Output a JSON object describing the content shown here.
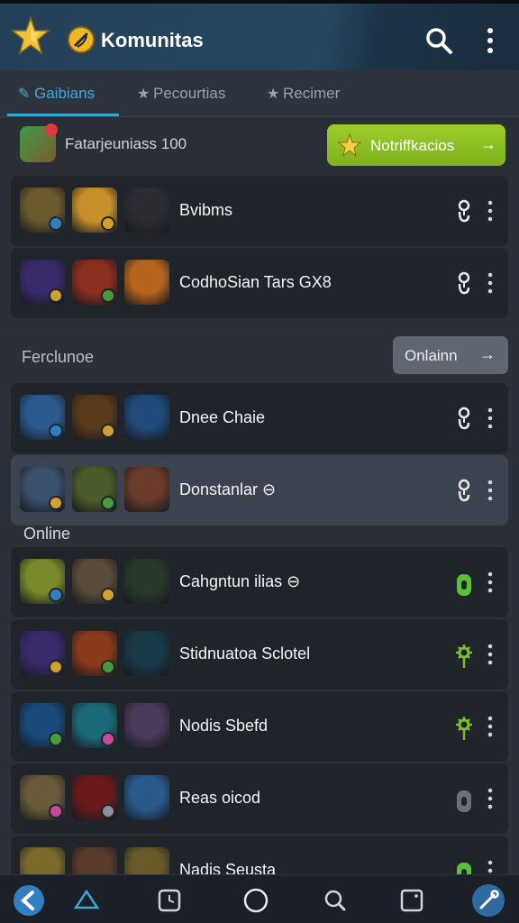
{
  "app": {
    "title": "Komunitas"
  },
  "tabs": [
    {
      "label": "Gaibians",
      "active": true
    },
    {
      "label": "Pecourtias",
      "active": false
    },
    {
      "label": "Recimer",
      "active": false
    }
  ],
  "promo": {
    "text": "Fatarjeuniass 100",
    "button_label": "Notriffkacios"
  },
  "rows_top": [
    {
      "label": "Bvibms",
      "status_icon": "link-icon",
      "thumbs": [
        "#6b5a2e",
        "#c8902a",
        "#2b2d33"
      ]
    },
    {
      "label": "CodhoSian Tars GX8",
      "status_icon": "link-icon",
      "thumbs": [
        "#3b2a6b",
        "#8a2e1e",
        "#b5651d"
      ]
    }
  ],
  "section_featured": {
    "title": "Ferclunoe",
    "button_label": "Onlainn"
  },
  "rows_featured": [
    {
      "label": "Dnee Chaie",
      "status_icon": "link-icon",
      "thumbs": [
        "#2c5a8f",
        "#5a3a1a",
        "#1f4a7a"
      ]
    },
    {
      "label": "Donstanlar ⊖",
      "status_icon": "link-icon",
      "thumbs": [
        "#3a4f6a",
        "#4a5a2a",
        "#6a3a2a"
      ]
    }
  ],
  "section_online": {
    "title": "Online"
  },
  "rows_online": [
    {
      "label": "Cahgntun ilias ⊖",
      "status_icon": "lock-icon",
      "status_color": "#5bbf3a",
      "thumbs": [
        "#7a8a2a",
        "#5a4a3a",
        "#2a3a2a"
      ]
    },
    {
      "label": "Stidnuatoa Sclotel",
      "status_icon": "gear-icon",
      "status_color": "#7bbf2a",
      "thumbs": [
        "#3a2a6a",
        "#8a3a1a",
        "#1a3a4a"
      ]
    },
    {
      "label": "Nodis Sbefd",
      "status_icon": "gear-icon",
      "status_color": "#7bbf2a",
      "thumbs": [
        "#1a4a7a",
        "#1a6a7a",
        "#4a3a5a"
      ]
    },
    {
      "label": "Reas oicod",
      "status_icon": "lock-icon",
      "status_color": "#6a707a",
      "thumbs": [
        "#6a5a3a",
        "#6a1a1a",
        "#2a5a8a"
      ]
    },
    {
      "label": "Nadis Seusta",
      "status_icon": "lock-icon",
      "status_color": "#5bbf3a",
      "thumbs": [
        "#7a6a2a",
        "#5a3a2a",
        "#6a5a2a"
      ]
    }
  ],
  "colors": {
    "accent": "#3ea4d6",
    "primary_button": "#8cc224",
    "online_green": "#5bbf3a"
  },
  "bottom_nav": [
    {
      "icon": "back-icon",
      "active": true
    },
    {
      "icon": "triangle-icon"
    },
    {
      "icon": "clock-square-icon"
    },
    {
      "icon": "home-circle-icon"
    },
    {
      "icon": "search-icon"
    },
    {
      "icon": "square-icon"
    },
    {
      "icon": "tools-icon",
      "active": true
    }
  ]
}
